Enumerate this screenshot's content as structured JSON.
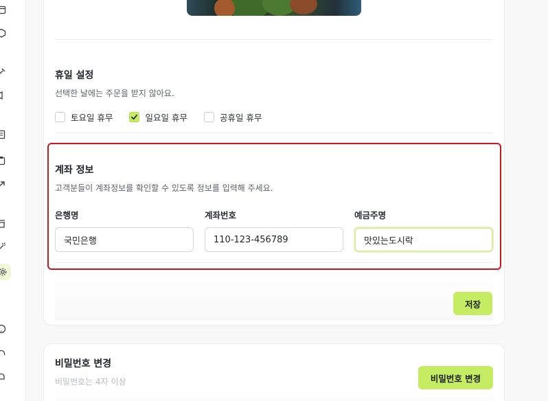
{
  "holiday": {
    "title": "휴일 설정",
    "description": "선택한 날에는 주문을 받지 않아요.",
    "options": [
      {
        "label": "토요일 휴무",
        "checked": false
      },
      {
        "label": "일요일 휴무",
        "checked": true
      },
      {
        "label": "공휴일 휴무",
        "checked": false
      }
    ]
  },
  "account": {
    "title": "계좌 정보",
    "description": "고객분들이 계좌정보를 확인할 수 있도록 정보를 입력해 주세요.",
    "bank_label": "은행명",
    "bank_value": "국민은행",
    "number_label": "계좌번호",
    "number_value": "110-123-456789",
    "holder_label": "예금주명",
    "holder_value": "맛있는도시락"
  },
  "save_label": "저장",
  "password": {
    "title": "비밀번호 변경",
    "description": "비밀번호는 4자 이상",
    "button_label": "비밀번호 변경"
  },
  "colors": {
    "accent": "#c5ec62",
    "highlight_border": "#d0161b"
  },
  "sidebar_icons": [
    "calendar-icon",
    "box-icon",
    "tools-icon",
    "megaphone-icon",
    "receipt-icon",
    "clipboard-icon",
    "trend-icon",
    "store-icon",
    "magic-icon",
    "gear-icon",
    "help-icon",
    "headset-icon",
    "bell-icon"
  ]
}
